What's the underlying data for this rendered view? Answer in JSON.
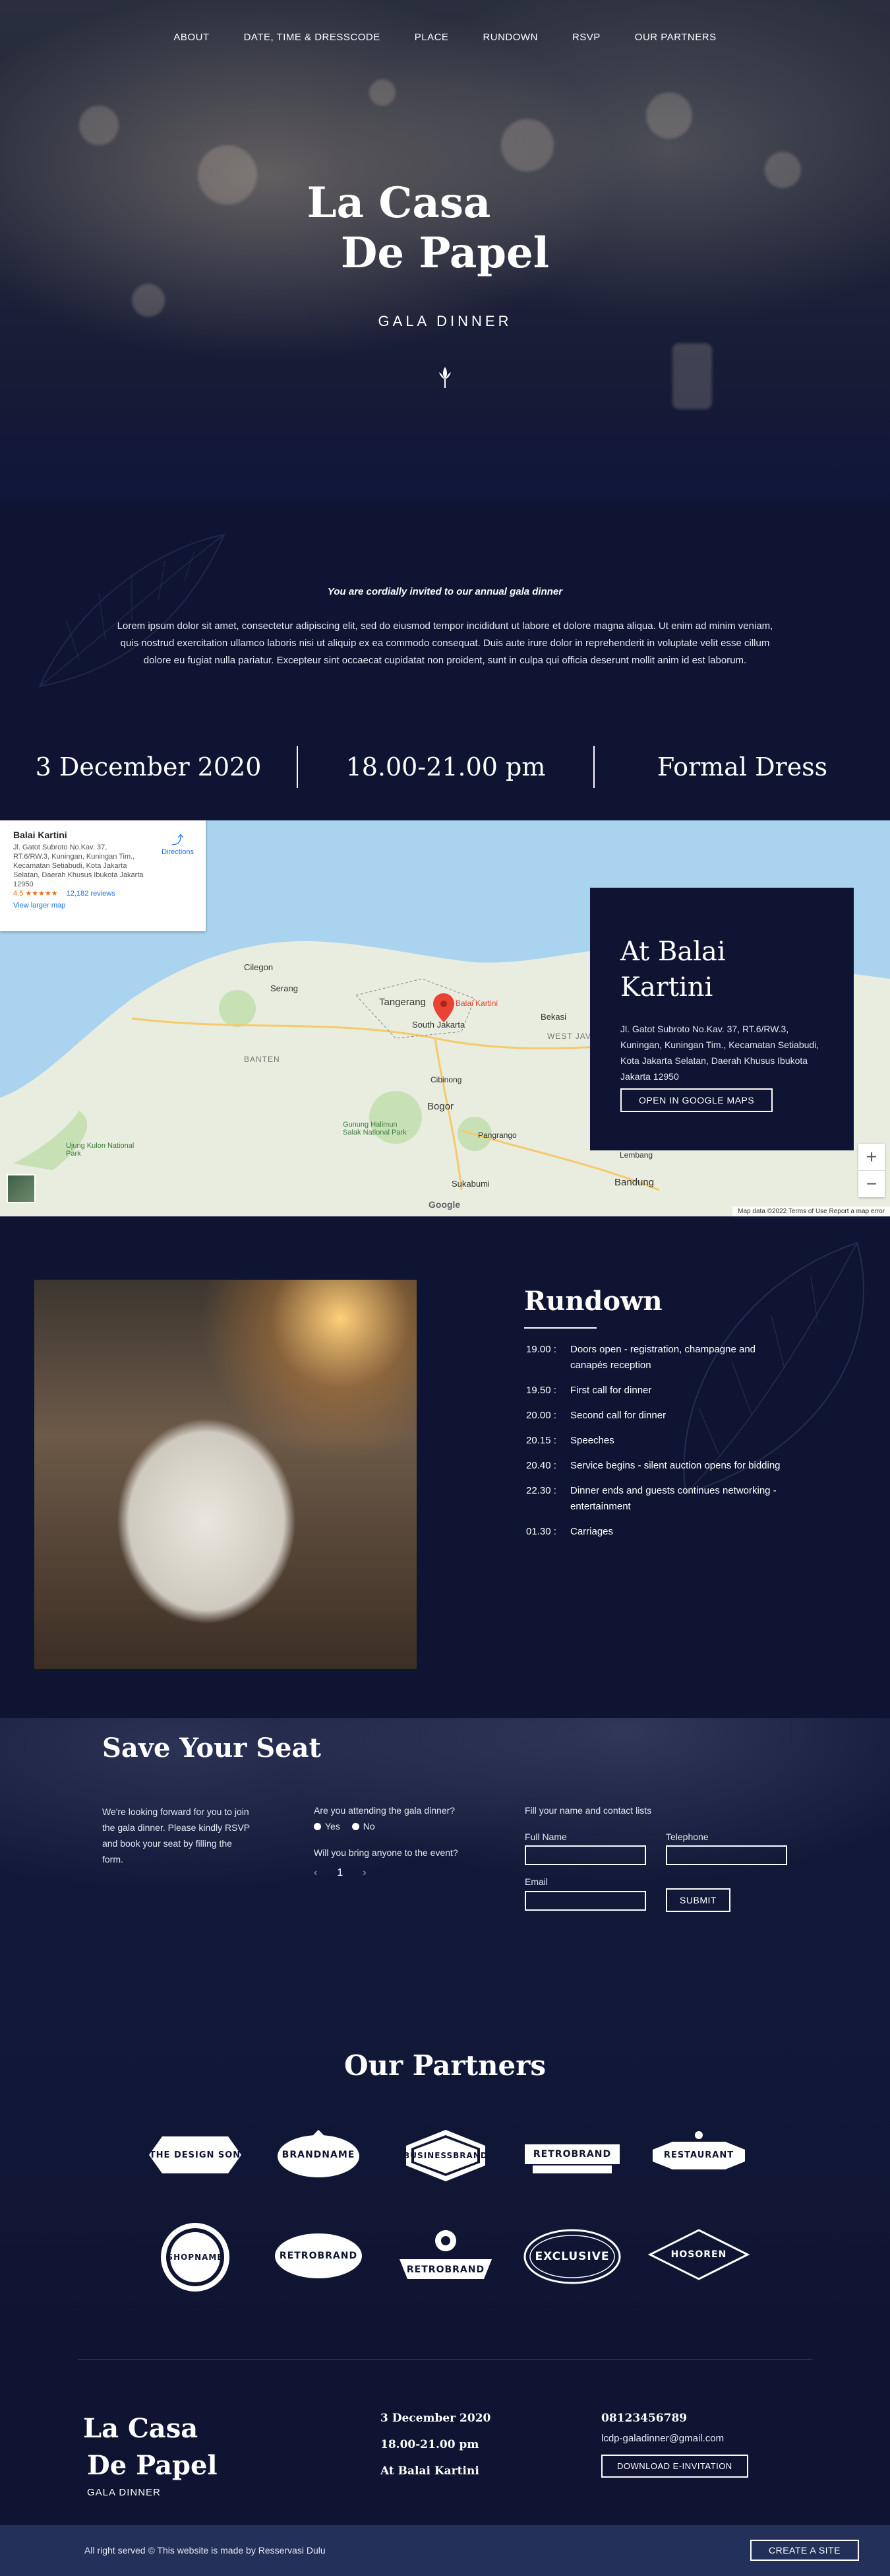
{
  "nav": {
    "items": [
      "ABOUT",
      "DATE, TIME & DRESSCODE",
      "PLACE",
      "RUNDOWN",
      "RSVP",
      "OUR PARTNERS"
    ]
  },
  "hero": {
    "title_line1": "La Casa",
    "title_line2": "De Papel",
    "subtitle": "GALA DINNER"
  },
  "invite": {
    "headline": "You are cordially invited to our annual gala dinner",
    "body": "Lorem ipsum dolor sit amet, consectetur adipiscing elit, sed do eiusmod tempor incididunt ut labore et dolore magna aliqua. Ut enim ad minim veniam, quis nostrud exercitation ullamco laboris nisi ut aliquip ex ea commodo consequat. Duis aute irure dolor in reprehenderit in voluptate velit esse cillum dolore eu fugiat nulla pariatur. Excepteur sint occaecat cupidatat non proident, sunt in culpa qui officia deserunt mollit anim id est laborum."
  },
  "facts": {
    "date": "3 December 2020",
    "time": "18.00-21.00 pm",
    "dresscode": "Formal Dress"
  },
  "map": {
    "card": {
      "name": "Balai Kartini",
      "address": "Jl. Gatot Subroto No.Kav. 37, RT.6/RW.3, Kuningan, Kuningan Tim., Kecamatan Setiabudi, Kota Jakarta Selatan, Daerah Khusus Ibukota Jakarta 12950",
      "rating": "4.5 ★★★★★",
      "reviews": "12,182 reviews",
      "larger_map": "View larger map",
      "directions": "Directions"
    },
    "zoom_in": "+",
    "zoom_out": "−",
    "google": "Google",
    "footer": "Map data ©2022   Terms of Use   Report a map error",
    "labels": {
      "balai": "Balai Kartini",
      "tangerang": "Tangerang",
      "south_jakarta": "South Jakarta",
      "bogor": "Bogor",
      "bandung": "Bandung",
      "serang": "Serang",
      "sukabumi": "Sukabumi",
      "banten": "BANTEN",
      "west_java": "WEST JAVA",
      "cilegon": "Cilegon",
      "bekasi": "Bekasi",
      "cibinong": "Cibinong",
      "lembang": "Lembang",
      "pangrango": "Pangrango",
      "gunung": "Gunung Halimun Salak National Park",
      "ujung": "Ujung Kulon National Park"
    }
  },
  "place": {
    "title_line1": "At Balai",
    "title_line2": "Kartini",
    "address": "Jl. Gatot Subroto No.Kav. 37, RT.6/RW.3, Kuningan, Kuningan Tim., Kecamatan Setiabudi, Kota Jakarta Selatan, Daerah Khusus Ibukota Jakarta 12950",
    "button": "OPEN IN GOOGLE MAPS"
  },
  "rundown": {
    "title": "Rundown",
    "items": [
      {
        "time": "19.00 :",
        "desc": "Doors open - registration, champagne and canapés reception"
      },
      {
        "time": "19.50 :",
        "desc": "First call for dinner"
      },
      {
        "time": "20.00 :",
        "desc": "Second call for dinner"
      },
      {
        "time": "20.15 :",
        "desc": "Speeches"
      },
      {
        "time": "20.40 :",
        "desc": "Service begins - silent auction opens for bidding"
      },
      {
        "time": "22.30 :",
        "desc": "Dinner ends and guests continues networking - entertainment"
      },
      {
        "time": "01.30 :",
        "desc": "Carriages"
      }
    ]
  },
  "rsvp": {
    "title": "Save Your Seat",
    "intro": "We're looking forward for you to join the gala dinner. Please kindly RSVP and book your seat by filling the form.",
    "q_attend": "Are you attending the gala dinner?",
    "opt_yes": "Yes",
    "opt_no": "No",
    "q_bring": "Will you bring anyone to the event?",
    "count": "1",
    "prev": "‹",
    "next": "›",
    "fill_label": "Fill your name and contact lists",
    "full_name": "Full Name",
    "telephone": "Telephone",
    "email": "Email",
    "submit": "SUBMIT"
  },
  "partners": {
    "title": "Our Partners",
    "logos": [
      "THE DESIGN SON",
      "BRANDNAME",
      "BUSINESSBRAND",
      "RETROBRAND",
      "RESTAURANT",
      "SHOPNAME",
      "RETROBRAND",
      "RETROBRAND",
      "EXCLUSIVE",
      "HOSOREN"
    ]
  },
  "footer": {
    "logo_line1": "La Casa",
    "logo_line2": "De Papel",
    "gala": "GALA DINNER",
    "date": "3 December 2020",
    "time": "18.00-21.00 pm",
    "place": "At Balai Kartini",
    "phone": "08123456789",
    "email": "lcdp-galadinner@gmail.com",
    "download": "DOWNLOAD E-INVITATION",
    "copyright": "All right served © This website is made by Resservasi Dulu",
    "create": "CREATE A SITE"
  },
  "colors": {
    "navy": "#0e1431",
    "bottom_bar": "#22305a",
    "map_water": "#a9d3ee",
    "map_land": "#e8eddf",
    "pin": "#ea4335"
  }
}
